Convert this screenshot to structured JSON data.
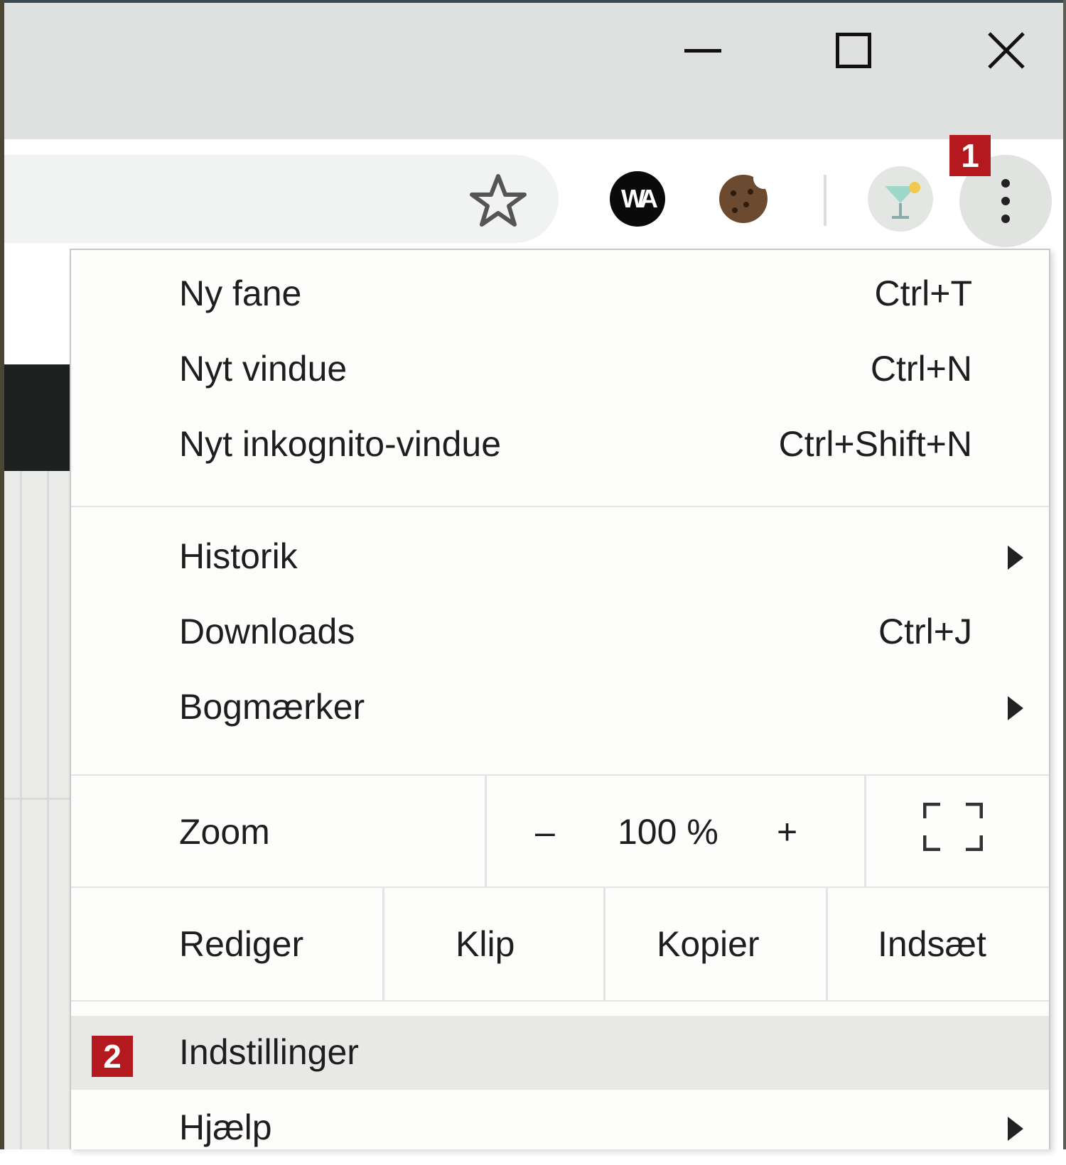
{
  "window": {
    "minimize_icon": "minimize-icon",
    "maximize_icon": "maximize-icon",
    "close_icon": "close-icon"
  },
  "toolbar": {
    "bookmark_icon": "star-icon",
    "extensions": [
      {
        "name": "wa-extension",
        "label": "WA"
      },
      {
        "name": "cookie-extension"
      },
      {
        "name": "drink-extension"
      }
    ],
    "menu_icon": "vertical-dots-icon"
  },
  "badges": {
    "menu": "1",
    "settings": "2"
  },
  "menu": {
    "group1": [
      {
        "label": "Ny fane",
        "shortcut": "Ctrl+T"
      },
      {
        "label": "Nyt vindue",
        "shortcut": "Ctrl+N"
      },
      {
        "label": "Nyt inkognito-vindue",
        "shortcut": "Ctrl+Shift+N"
      }
    ],
    "group2": [
      {
        "label": "Historik",
        "submenu": true
      },
      {
        "label": "Downloads",
        "shortcut": "Ctrl+J"
      },
      {
        "label": "Bogmærker",
        "submenu": true
      }
    ],
    "zoom": {
      "label": "Zoom",
      "minus": "–",
      "value": "100 %",
      "plus": "+",
      "fullscreen_icon": "fullscreen-icon"
    },
    "edit": {
      "label": "Rediger",
      "cut": "Klip",
      "copy": "Kopier",
      "paste": "Indsæt"
    },
    "group3": [
      {
        "label": "Indstillinger",
        "highlighted": true
      },
      {
        "label": "Hjælp",
        "submenu": true
      }
    ]
  },
  "colors": {
    "badge": "#b3191f",
    "titlebar": "#dee1e0",
    "menu_bg": "#fdfdfb",
    "highlight": "#e8e8e6"
  }
}
